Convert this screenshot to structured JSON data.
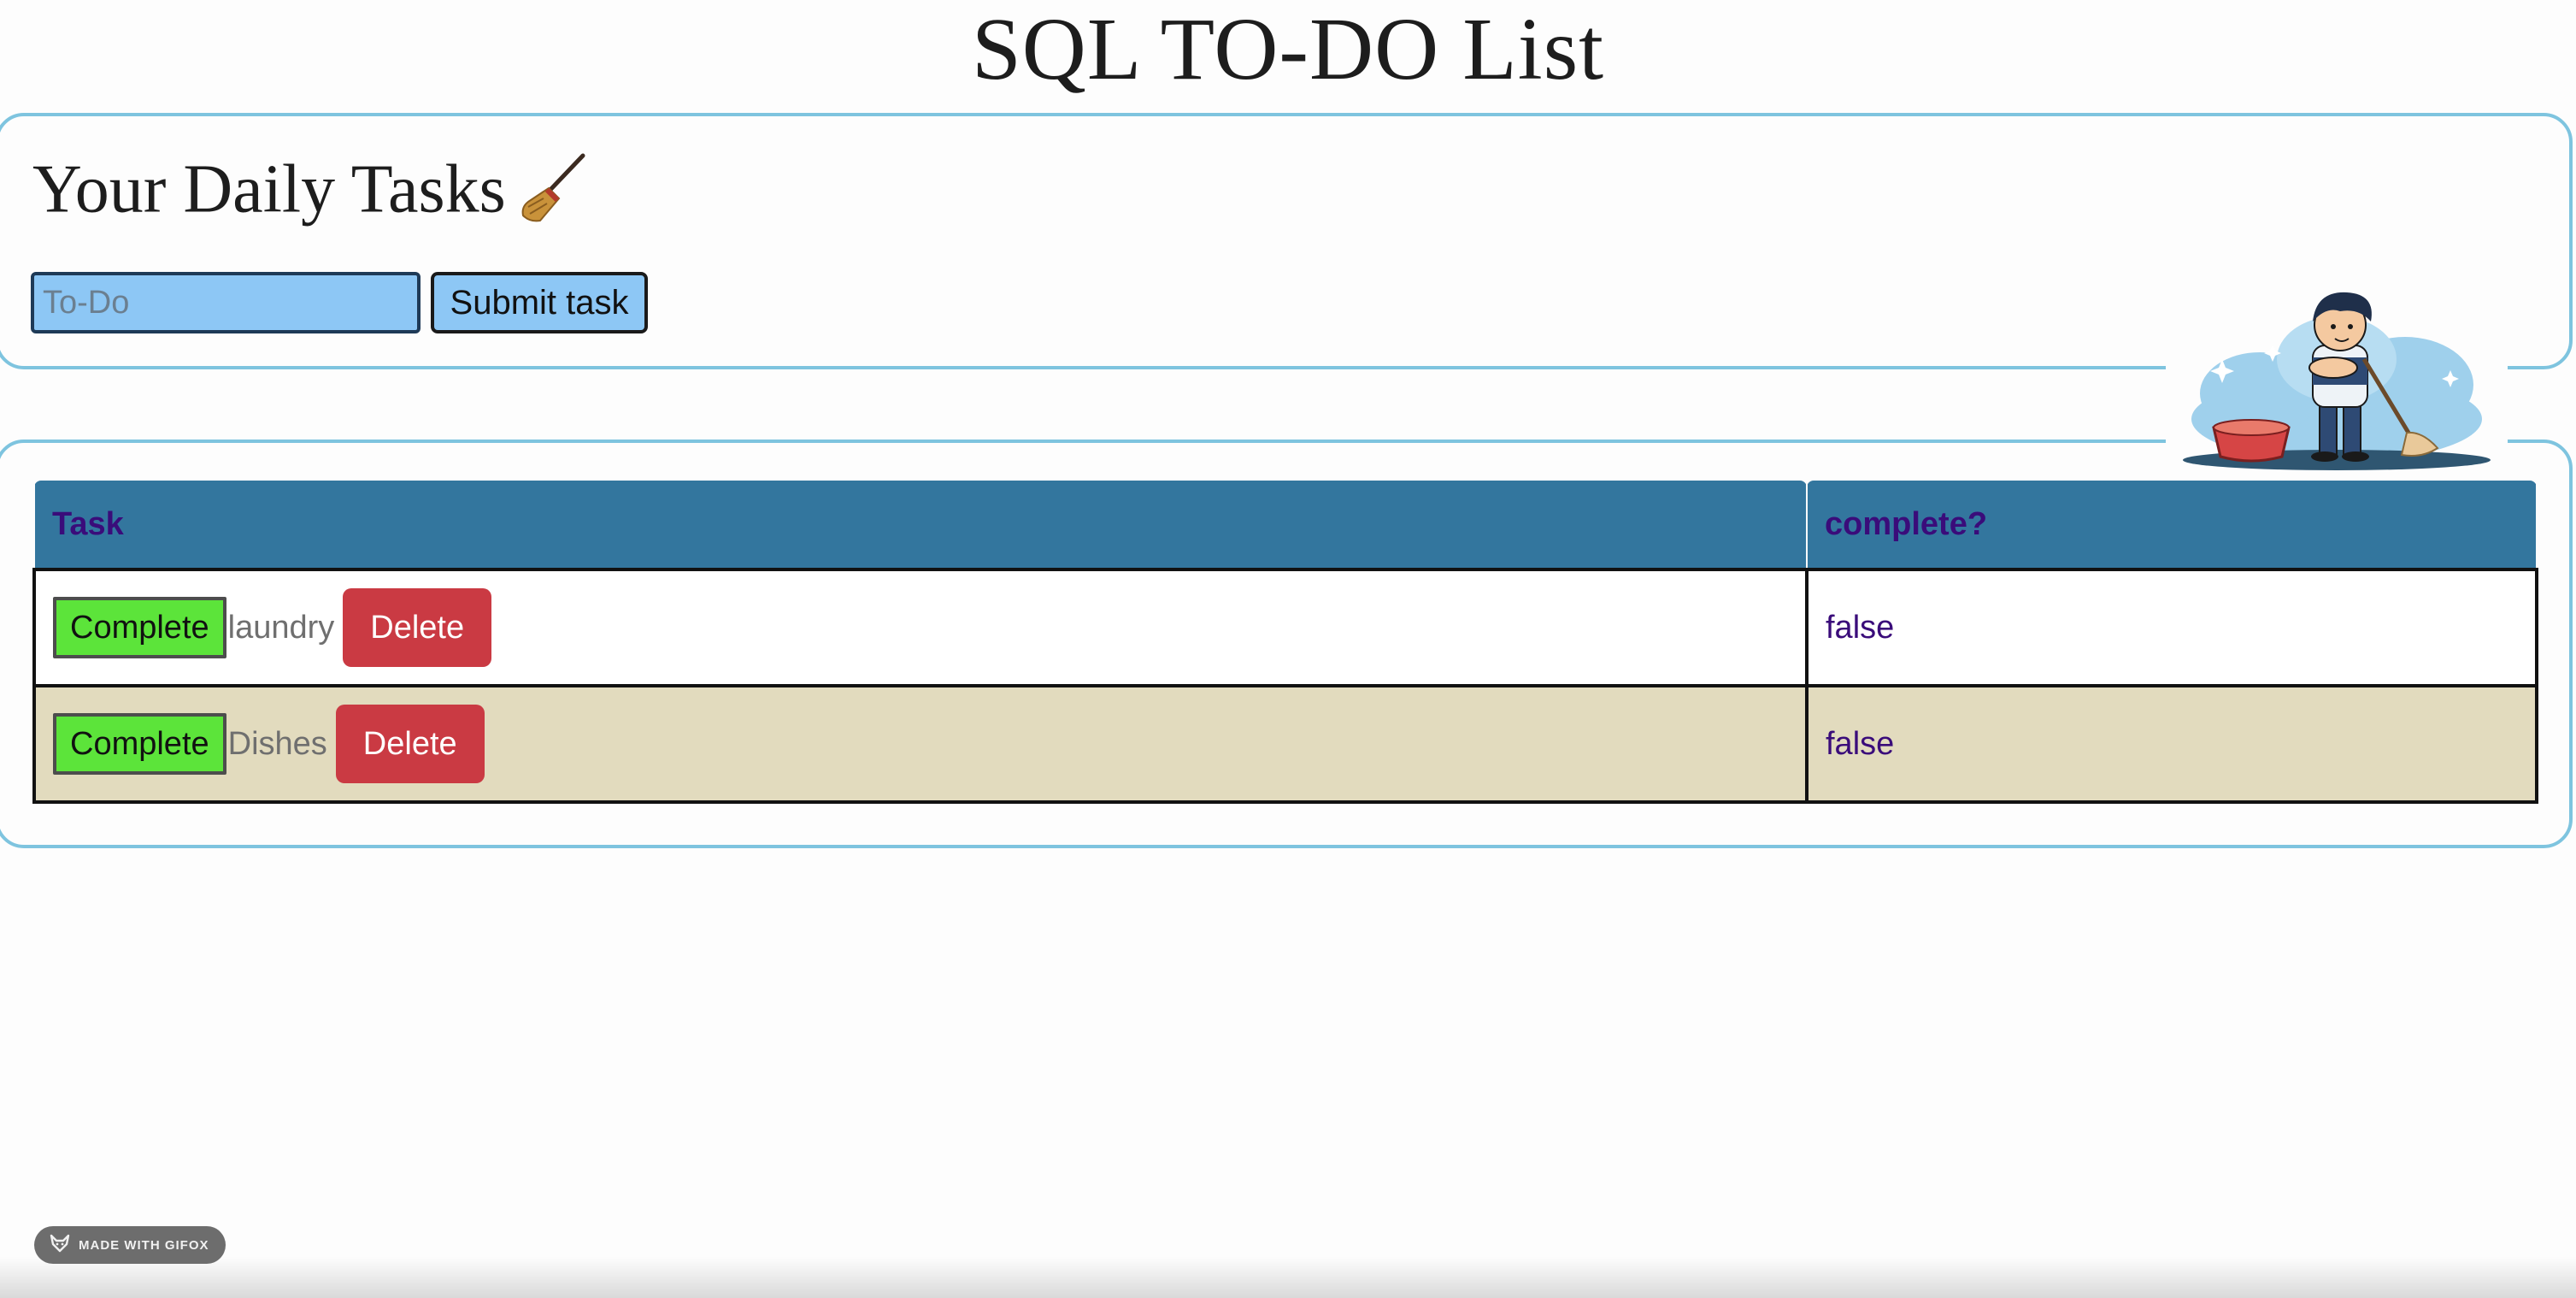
{
  "header": {
    "title": "SQL TO-DO List"
  },
  "form": {
    "heading": "Your Daily Tasks",
    "heading_icon": "broom-icon",
    "input_value": "",
    "input_placeholder": "To-Do",
    "submit_label": "Submit task"
  },
  "table": {
    "columns": [
      "Task",
      "complete?"
    ],
    "rows": [
      {
        "complete_label": "Complete",
        "task": "laundry",
        "delete_label": "Delete",
        "status": "false"
      },
      {
        "complete_label": "Complete",
        "task": "Dishes",
        "delete_label": "Delete",
        "status": "false"
      }
    ]
  },
  "badge": {
    "text": "MADE WITH GIFOX",
    "icon": "fox-icon"
  },
  "colors": {
    "accent_border": "#7ec4df",
    "table_header": "#33769e",
    "header_text": "#3a0c7a",
    "complete_button": "#5ce43a",
    "delete_button": "#ca3a43",
    "input_bg": "#8dc7f5",
    "alt_row": "#e2dbbe"
  }
}
